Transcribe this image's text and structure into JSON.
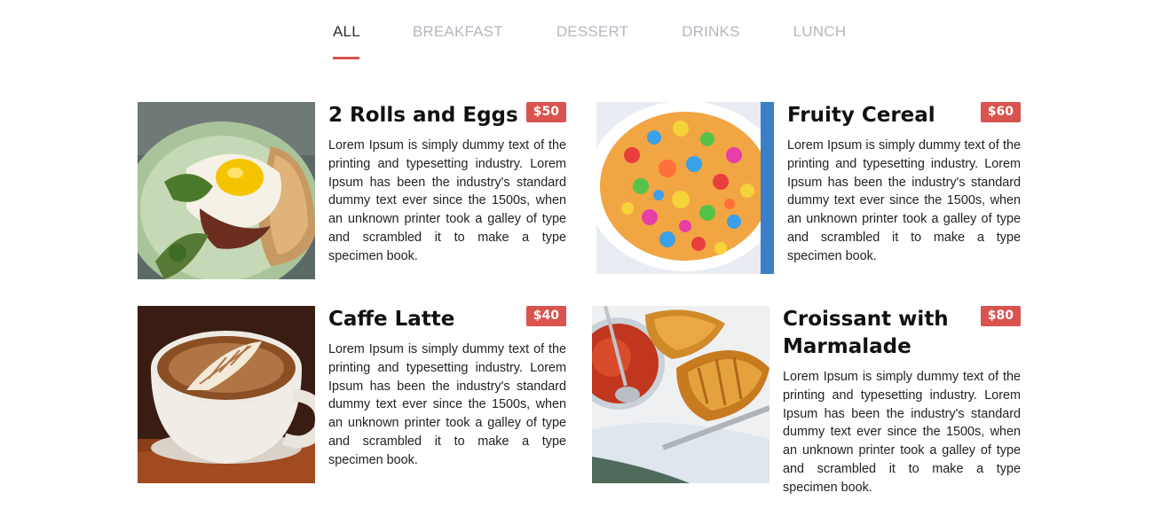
{
  "tabs": [
    {
      "label": "ALL",
      "active": true
    },
    {
      "label": "BREAKFAST",
      "active": false
    },
    {
      "label": "DESSERT",
      "active": false
    },
    {
      "label": "DRINKS",
      "active": false
    },
    {
      "label": "LUNCH",
      "active": false
    }
  ],
  "items": [
    {
      "title": "2 Rolls and Eggs",
      "price": "$50",
      "description": "Lorem Ipsum is simply dummy text of the printing and typesetting industry. Lorem Ipsum has been the industry's standard dummy text ever since the 1500s, when an unknown printer took a galley of type and scrambled it to make a type specimen book."
    },
    {
      "title": "Fruity Cereal",
      "price": "$60",
      "description": "Lorem Ipsum is simply dummy text of the printing and typesetting industry. Lorem Ipsum has been the industry's standard dummy text ever since the 1500s, when an unknown printer took a galley of type and scrambled it to make a type specimen book."
    },
    {
      "title": "Caffe Latte",
      "price": "$40",
      "description": "Lorem Ipsum is simply dummy text of the printing and typesetting industry. Lorem Ipsum has been the industry's standard dummy text ever since the 1500s, when an unknown printer took a galley of type and scrambled it to make a type specimen book."
    },
    {
      "title": "Croissant with Marmalade",
      "price": "$80",
      "description": "Lorem Ipsum is simply dummy text of the printing and typesetting industry. Lorem Ipsum has been the industry's standard dummy text ever since the 1500s, when an unknown printer took a galley of type and scrambled it to make a type specimen book."
    }
  ],
  "colors": {
    "accent": "#d9534f",
    "tab_active": "#2b2d33",
    "tab_inactive": "#b4b7bf"
  }
}
